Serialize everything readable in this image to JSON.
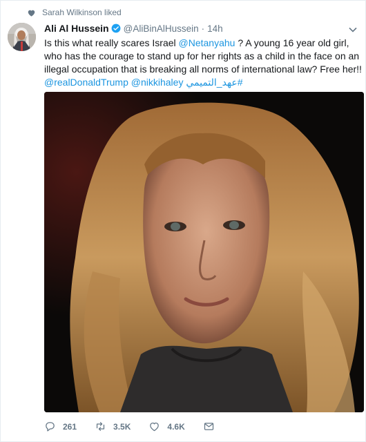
{
  "social_context": {
    "icon": "heart-icon",
    "text": "Sarah Wilkinson liked"
  },
  "tweet": {
    "author_name": "Ali Al Hussein",
    "verified": true,
    "handle": "@AliBinAlHussein",
    "separator": "·",
    "time": "14h",
    "text_part1": "Is this what really scares Israel ",
    "mention1": "@Netanyahu",
    "text_part2": " ? A young 16 year old girl, who has the courage to stand up for her rights as a child in the face on an illegal occupation that is breaking all norms of international law? Free her!!",
    "mention2": "@realDonaldTrump",
    "mention3": "@nikkihaley",
    "hashtag": "#عهد_التميمي"
  },
  "actions": {
    "reply_count": "261",
    "retweet_count": "3.5K",
    "like_count": "4.6K"
  },
  "colors": {
    "link": "#1b95e0",
    "muted": "#657786",
    "verified": "#1da1f2"
  }
}
